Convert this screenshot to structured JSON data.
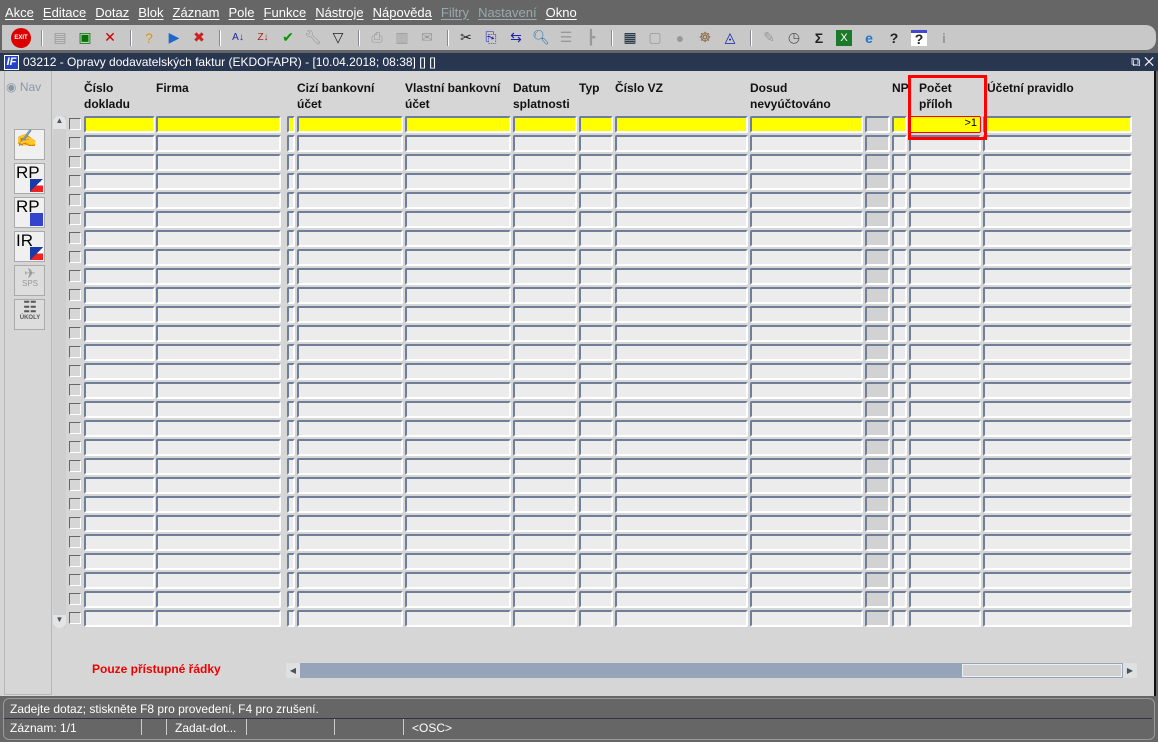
{
  "menu": [
    "Akce",
    "Editace",
    "Dotaz",
    "Blok",
    "Záznam",
    "Pole",
    "Funkce",
    "Nástroje",
    "Nápověda",
    "Filtry",
    "Nastavení",
    "Okno"
  ],
  "menu_disabled": [
    "Filtry",
    "Nastavení"
  ],
  "toolbar": {
    "exit_label": "EXIT"
  },
  "window": {
    "title": "03212 - Opravy dodavatelských faktur (EKDOFAPR) - [10.04.2018; 08:38]  [] []",
    "icon_label": "IF"
  },
  "nav": {
    "label": "Nav",
    "buttons": [
      {
        "label": ""
      },
      {
        "label": "RP"
      },
      {
        "label": "RP"
      },
      {
        "label": "IR"
      },
      {
        "label": "SPS"
      },
      {
        "label": "ÚKOLY"
      }
    ]
  },
  "columns": [
    {
      "l1": "Číslo",
      "l2": "dokladu"
    },
    {
      "l1": "Firma",
      "l2": ""
    },
    {
      "l1": "",
      "l2": ""
    },
    {
      "l1": "Cizí bankovní",
      "l2": "účet"
    },
    {
      "l1": "Vlastní bankovní",
      "l2": "účet"
    },
    {
      "l1": "Datum",
      "l2": "splatnosti"
    },
    {
      "l1": "Typ",
      "l2": ""
    },
    {
      "l1": "Číslo VZ",
      "l2": ""
    },
    {
      "l1": "Dosud",
      "l2": "nevyúčtováno"
    },
    {
      "l1": "",
      "l2": ""
    },
    {
      "l1": "NP",
      "l2": ""
    },
    {
      "l1": "Počet",
      "l2": "příloh"
    },
    {
      "l1": "Účetní pravidlo",
      "l2": ""
    }
  ],
  "first_row": {
    "pocet_priloh": ">1"
  },
  "row_count": 27,
  "footer": {
    "note": "Pouze přístupné řádky"
  },
  "status": {
    "message": "Zadejte dotaz; stiskněte F8 pro provedení, F4 pro zrušení.",
    "record": "Záznam: 1/1",
    "mode": "Zadat-dot...",
    "osc": "<OSC>"
  },
  "colors": {
    "current_row": "#ffff00",
    "highlight": "#ff0000",
    "title_bar": "#283650"
  }
}
